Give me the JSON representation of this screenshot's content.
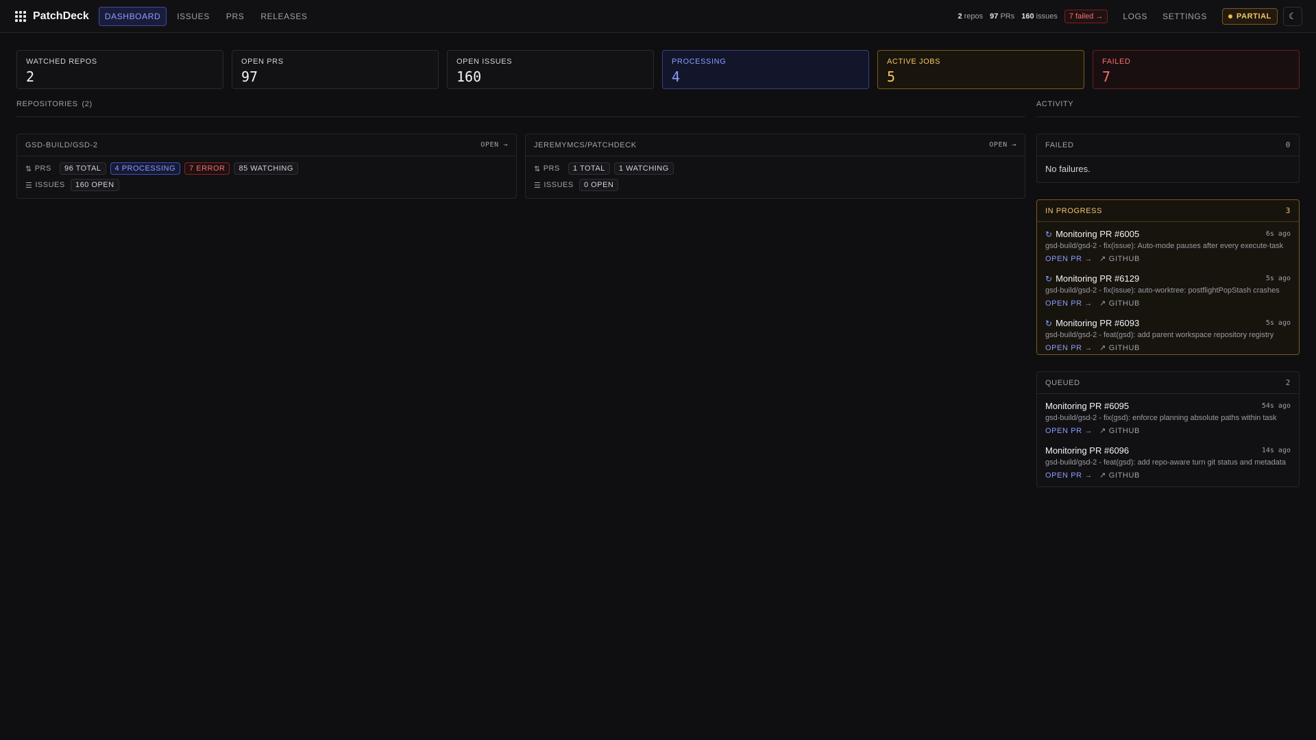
{
  "app": {
    "brand": "PatchDeck"
  },
  "nav": [
    {
      "label": "DASHBOARD"
    },
    {
      "label": "ISSUES"
    },
    {
      "label": "PRS"
    },
    {
      "label": "RELEASES"
    }
  ],
  "header_stats": {
    "repos_count": "2",
    "repos_label": "repos",
    "prs_count": "97",
    "prs_label": "PRs",
    "issues_count": "160",
    "issues_label": "issues",
    "failed_pill": "7 failed →"
  },
  "header_links": {
    "logs": "LOGS",
    "settings": "SETTINGS",
    "partial": "PARTIAL"
  },
  "cards": [
    {
      "label": "WATCHED REPOS",
      "value": "2"
    },
    {
      "label": "OPEN PRS",
      "value": "97"
    },
    {
      "label": "OPEN ISSUES",
      "value": "160"
    },
    {
      "label": "PROCESSING",
      "value": "4"
    },
    {
      "label": "ACTIVE JOBS",
      "value": "5"
    },
    {
      "label": "FAILED",
      "value": "7"
    }
  ],
  "repositories": {
    "title": "REPOSITORIES",
    "count": "(2)",
    "items": [
      {
        "name": "GSD-BUILD/GSD-2",
        "open": "OPEN →",
        "prs_label": "PRS",
        "issues_label": "ISSUES",
        "pr_tags": [
          "96 TOTAL",
          "4 PROCESSING",
          "7 ERROR",
          "85 WATCHING"
        ],
        "issue_tags": [
          "160 OPEN"
        ]
      },
      {
        "name": "JEREMYMCS/PATCHDECK",
        "open": "OPEN →",
        "prs_label": "PRS",
        "issues_label": "ISSUES",
        "pr_tags": [
          "1 TOTAL",
          "1 WATCHING"
        ],
        "issue_tags": [
          "0 OPEN"
        ]
      }
    ]
  },
  "activity": {
    "title": "ACTIVITY",
    "failed": {
      "title": "FAILED",
      "count": "0",
      "empty": "No failures."
    },
    "in_progress": {
      "title": "IN PROGRESS",
      "count": "3",
      "jobs": [
        {
          "title": "Monitoring PR #6005",
          "time": "6s ago",
          "desc": "gsd-build/gsd-2 - fix(issue): Auto-mode pauses after every execute-task",
          "open": "OPEN PR →",
          "github": "GITHUB"
        },
        {
          "title": "Monitoring PR #6129",
          "time": "5s ago",
          "desc": "gsd-build/gsd-2 - fix(issue): auto-worktree: postflightPopStash crashes",
          "open": "OPEN PR →",
          "github": "GITHUB"
        },
        {
          "title": "Monitoring PR #6093",
          "time": "5s ago",
          "desc": "gsd-build/gsd-2 - feat(gsd): add parent workspace repository registry",
          "open": "OPEN PR →",
          "github": "GITHUB"
        }
      ]
    },
    "queued": {
      "title": "QUEUED",
      "count": "2",
      "jobs": [
        {
          "title": "Monitoring PR #6095",
          "time": "54s ago",
          "desc": "gsd-build/gsd-2 - fix(gsd): enforce planning absolute paths within task",
          "open": "OPEN PR →",
          "github": "GITHUB"
        },
        {
          "title": "Monitoring PR #6096",
          "time": "14s ago",
          "desc": "gsd-build/gsd-2 - feat(gsd): add repo-aware turn git status and metadata",
          "open": "OPEN PR →",
          "github": "GITHUB"
        }
      ]
    }
  },
  "colors": {
    "accent": "#8b9dff",
    "warning": "#f5c46b",
    "danger": "#f87171",
    "background": "#0f0f11"
  },
  "icons": {
    "logo": "grid-icon",
    "theme": "moon-icon",
    "pr": "git-pull-request-icon",
    "issue": "list-icon",
    "spinner": "spinner-icon",
    "external": "external-link-icon"
  }
}
